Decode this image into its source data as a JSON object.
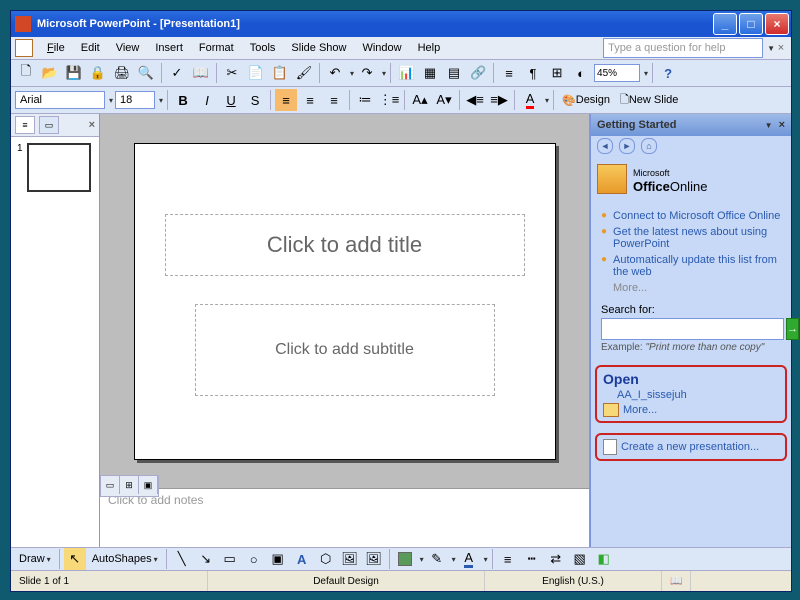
{
  "titlebar": {
    "app": "Microsoft PowerPoint",
    "doc": "[Presentation1]"
  },
  "menu": {
    "file": "File",
    "edit": "Edit",
    "view": "View",
    "insert": "Insert",
    "format": "Format",
    "tools": "Tools",
    "slideshow": "Slide Show",
    "window": "Window",
    "help": "Help",
    "helpbox": "Type a question for help"
  },
  "toolbar": {
    "zoom": "45%",
    "font": "Arial",
    "size": "18",
    "design": "Design",
    "newslide": "New Slide"
  },
  "outline": {
    "slidenum": "1"
  },
  "slide": {
    "title_placeholder": "Click to add title",
    "subtitle_placeholder": "Click to add subtitle"
  },
  "notes": {
    "placeholder": "Click to add notes"
  },
  "taskpane": {
    "header": "Getting Started",
    "office_prefix": "Microsoft",
    "office_brand": "Office",
    "office_suffix": "Online",
    "links": [
      "Connect to Microsoft Office Online",
      "Get the latest news about using PowerPoint",
      "Automatically update this list from the web"
    ],
    "more": "More...",
    "search_label": "Search for:",
    "example_label": "Example:",
    "example_text": "\"Print more than one copy\"",
    "open_header": "Open",
    "recent": "AA_I_sissejuh",
    "open_more": "More...",
    "create": "Create a new presentation..."
  },
  "draw": {
    "label": "Draw",
    "autoshapes": "AutoShapes"
  },
  "status": {
    "slide": "Slide 1 of 1",
    "design": "Default Design",
    "lang": "English (U.S.)"
  }
}
